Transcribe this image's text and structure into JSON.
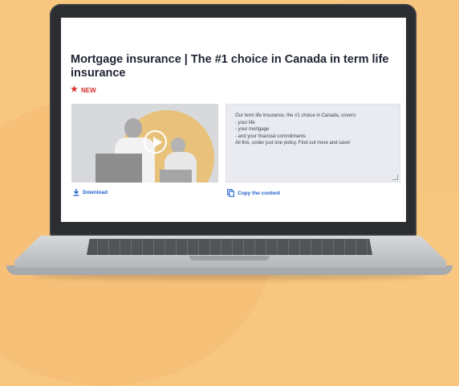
{
  "page": {
    "title": "Mortgage insurance | The #1 choice in Canada in term life insurance",
    "badge": "NEW"
  },
  "media": {
    "play_icon": "play-icon"
  },
  "description": {
    "lines": [
      "Our term life insurance, the #1 choice in Canada, covers:",
      "- your life",
      "- your mortgage",
      "- and your financial commitments",
      "All this, under just one policy. Find out more and save!"
    ]
  },
  "actions": {
    "download_label": "Download",
    "copy_label": "Copy the content"
  },
  "colors": {
    "accent": "#1e5fc9",
    "badge": "#d62b2b",
    "background": "#f8c77f"
  }
}
